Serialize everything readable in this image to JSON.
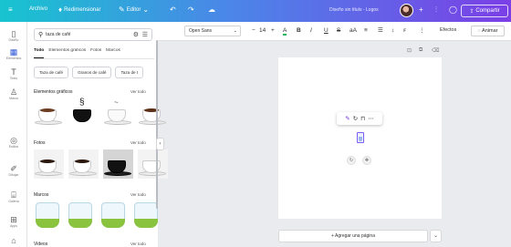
{
  "topbar": {
    "home_icon": "menu-icon",
    "archivo": "Archivo",
    "redimensionar": "Redimensionar",
    "editor": "Editor",
    "title": "Diseño sin título - Logos",
    "share": "Compartir"
  },
  "rail": [
    "Diseño",
    "Elementos",
    "Texto",
    "Marca",
    "Estilos",
    "Dibujar",
    "Galería",
    "Apps"
  ],
  "panel": {
    "search_value": "taza de café",
    "tabs": [
      "Todo",
      "Elementos gráficos",
      "Fotos",
      "Marcos"
    ],
    "chips": [
      "Taza de café",
      "Granos de café",
      "Taza de t"
    ],
    "sections": {
      "graphics": "Elementos gráficos",
      "photos": "Fotos",
      "frames": "Marcos",
      "videos": "Videos",
      "see_all": "Ver todo"
    }
  },
  "toolbar": {
    "font": "Open Sans",
    "size": "14",
    "effects": "Efectos",
    "animate": "Animar"
  },
  "canvas": {
    "add_page": "+ Agregar una página"
  },
  "colors": {
    "accent": "#7b3fe6",
    "topbar_start": "#17c4cf",
    "topbar_end": "#7b3fe6"
  }
}
